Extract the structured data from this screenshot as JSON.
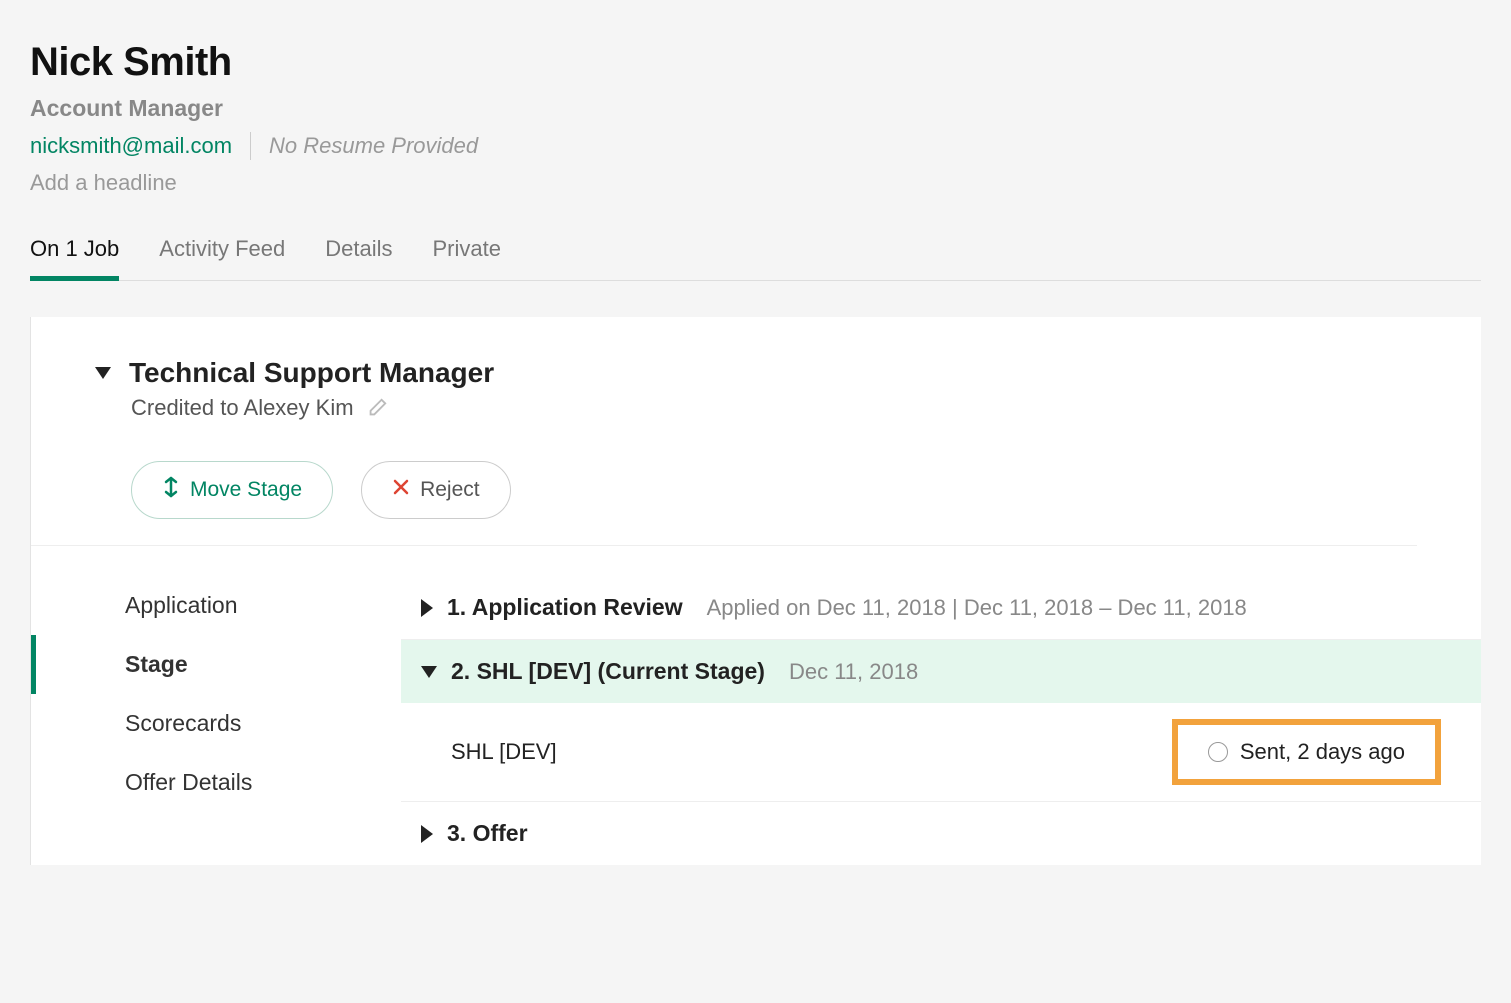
{
  "candidate": {
    "name": "Nick Smith",
    "title": "Account Manager",
    "email": "nicksmith@mail.com",
    "resume_note": "No Resume Provided",
    "headline_placeholder": "Add a headline"
  },
  "tabs": [
    {
      "label": "On 1 Job"
    },
    {
      "label": "Activity Feed"
    },
    {
      "label": "Details"
    },
    {
      "label": "Private"
    }
  ],
  "job": {
    "title": "Technical Support Manager",
    "credited_to": "Credited to Alexey Kim",
    "actions": {
      "move_label": "Move Stage",
      "reject_label": "Reject"
    },
    "side_nav": [
      {
        "label": "Application"
      },
      {
        "label": "Stage"
      },
      {
        "label": "Scorecards"
      },
      {
        "label": "Offer Details"
      }
    ],
    "stages": [
      {
        "num_title": "1.  Application Review",
        "meta": "Applied on Dec 11, 2018 | Dec 11, 2018 – Dec 11, 2018"
      },
      {
        "num_title": "2.  SHL [DEV] (Current Stage)",
        "meta": "Dec 11, 2018",
        "detail_label": "SHL [DEV]",
        "status": "Sent, 2 days ago"
      },
      {
        "num_title": "3.  Offer",
        "meta": ""
      }
    ]
  }
}
